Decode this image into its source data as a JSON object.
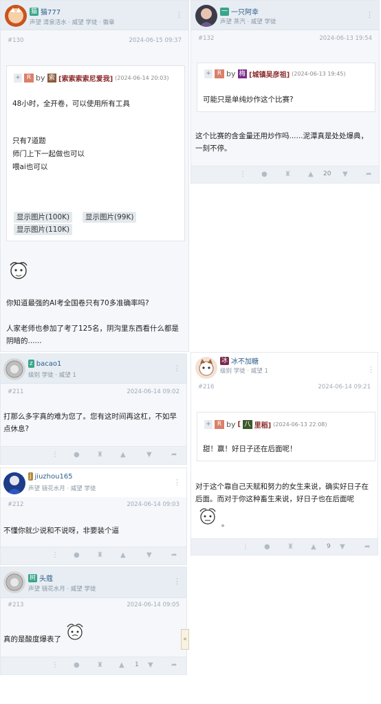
{
  "posts": {
    "p130": {
      "username": "猫777",
      "user_tag": "猫",
      "sub": "声望 清泉活水 · 威望 学徒 · 徽章",
      "floor": "#130",
      "time": "2024-06-15 09:37",
      "quote": {
        "plus": "+",
        "r": "R",
        "by": "by",
        "name_tag": "索",
        "name": "[索索索索尼爱我]",
        "time": "(2024-06-14 20:03)",
        "lines": [
          "48小时，全开卷，可以使用所有工具",
          "只有7道题",
          "师门上下一起做也可以",
          "喂ai也可以"
        ],
        "buttons": [
          "显示图片(100K)",
          "显示图片(99K)",
          "显示图片(110K)"
        ]
      },
      "lines": [
        "你知道最强的AI考全国卷只有70多准确率吗?",
        "人家老师也参加了考了125名，阴沟里东西看什么都是",
        "阴暗的......"
      ]
    },
    "p132": {
      "username": "一只阿幸",
      "user_tag": "一",
      "sub": "声望 蒸汽 · 威望 学徒",
      "floor": "#132",
      "time": "2024-06-13 19:54",
      "quote": {
        "plus": "+",
        "r": "R",
        "by": "by",
        "name_tag": "梅",
        "name": "[城镇吴彦祖]",
        "time": "(2024-06-13 19:45)",
        "lines": [
          "可能只是单纯炒作这个比赛?"
        ]
      },
      "lines": [
        "这个比赛的含金量还用炒作吗......泥潭真是处处爆典，",
        "一刻不停。"
      ],
      "likes": "20"
    },
    "p211": {
      "username": "bacao1",
      "user_tag": "z",
      "sub": "级别 学徒 · 威望 1",
      "floor": "#211",
      "time": "2024-06-14 09:02",
      "lines": [
        "打那么多字真的难为您了。您有这时间再这杠，不如早",
        "点休息?"
      ]
    },
    "p216": {
      "username": "冰不加糖",
      "user_tag": "冰",
      "sub": "级别 学徒 · 威望 1",
      "floor": "#216",
      "time": "2024-06-14 09:21",
      "quote": {
        "plus": "+",
        "r": "R",
        "by": "by",
        "name_tag": "八",
        "name": "里稻]",
        "open": "[",
        "time": "(2024-06-13 22:08)",
        "lines": [
          "甜！赢！好日子还在后面呢！"
        ]
      },
      "lines": [
        "对于这个靠自己天赋和努力的女生来说，确实好日子在",
        "后面。而对于你这种畜生来说，好日子也在后面呢",
        "。"
      ],
      "likes": "9"
    },
    "p212": {
      "username": "jiuzhou165",
      "user_tag": "j",
      "sub": "声望 镜花水月 · 威望 学徒",
      "floor": "#212",
      "time": "2024-06-14 09:03",
      "lines": [
        "不懂你就少说和不说呀，非要装个逼"
      ]
    },
    "p213": {
      "username": "头蔻",
      "user_tag": "树",
      "sub": "声望 镜花水月 · 威望 学徒",
      "floor": "#213",
      "time": "2024-06-14 09:05",
      "lines": [
        "真的是酸度爆表了"
      ],
      "likes": "1"
    }
  },
  "icons": {
    "kebab": "⋮",
    "comment": "●",
    "gift": "♜",
    "like": "▲",
    "dislike": "▼",
    "share": "➦",
    "collapse": "«"
  },
  "colors": {
    "link": "#2a5d8a",
    "quote_name": "#8a2a2a",
    "r_tag": "#d9806a"
  }
}
